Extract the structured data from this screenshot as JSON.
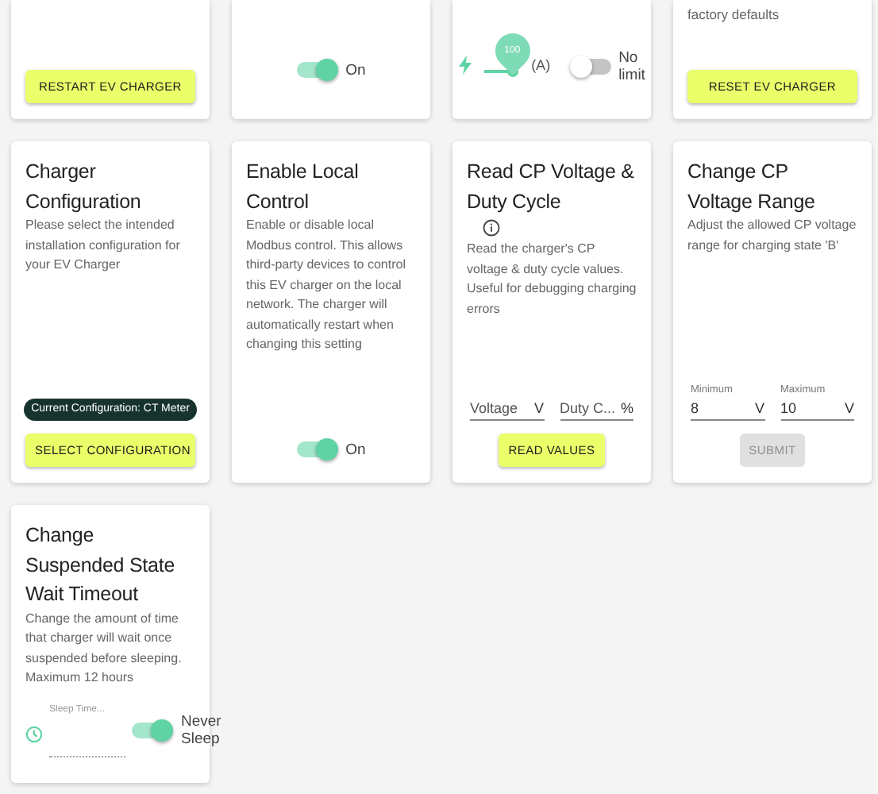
{
  "top_cards": [
    {
      "kind": "button",
      "button": {
        "label": "RESTART EV CHARGER",
        "disabled": false
      }
    },
    {
      "kind": "toggle",
      "toggle": {
        "label": "On",
        "on": true
      }
    },
    {
      "kind": "current-limit",
      "slider": {
        "value": "100",
        "unit": "(A)"
      },
      "toggle": {
        "label": "No limit",
        "on": false
      }
    },
    {
      "kind": "button",
      "description": "factory defaults",
      "button": {
        "label": "RESET EV CHARGER",
        "disabled": false
      }
    }
  ],
  "cards": [
    {
      "title": "Charger Configuration",
      "description": "Please select the intended installation configuration for your EV Charger",
      "badge": "Current Configuration: CT Meter",
      "button": {
        "label": "SELECT CONFIGURATION",
        "disabled": false
      }
    },
    {
      "title": "Enable Local Control",
      "description": "Enable or disable local Modbus control. This allows third-party devices to control this EV charger on the local network. The charger will automatically restart when changing this setting",
      "toggle": {
        "label": "On",
        "on": true
      }
    },
    {
      "title": "Read CP Voltage & Duty Cycle",
      "info_icon": true,
      "description": "Read the charger's CP voltage & duty cycle values. Useful for debugging charging errors",
      "fields": [
        {
          "placeholder": "Voltage",
          "suffix": "V"
        },
        {
          "placeholder": "Duty C...",
          "suffix": "%"
        }
      ],
      "button": {
        "label": "READ VALUES",
        "disabled": false
      }
    },
    {
      "title": "Change CP Voltage Range",
      "description": "Adjust the allowed CP voltage range for charging state 'B'",
      "fields": [
        {
          "label": "Minimum",
          "value": "8",
          "suffix": "V"
        },
        {
          "label": "Maximum",
          "value": "10",
          "suffix": "V"
        }
      ],
      "button": {
        "label": "SUBMIT",
        "disabled": true
      }
    },
    {
      "title": "Change Suspended State Wait Timeout",
      "description": "Change the amount of time that charger will wait once suspended before sleeping. Maximum 12 hours",
      "timer_field": {
        "placeholder": "Sleep Time..."
      },
      "toggle": {
        "label": "Never Sleep",
        "on": true
      }
    }
  ]
}
